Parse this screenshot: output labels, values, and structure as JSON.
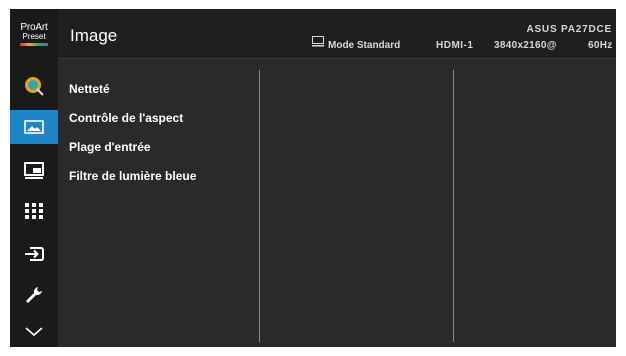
{
  "logo": {
    "line1": "ProArt",
    "line2": "Preset"
  },
  "sidebar": {
    "items": [
      {
        "icon": "palette-icon",
        "active": false
      },
      {
        "icon": "image-icon",
        "active": true
      },
      {
        "icon": "pip-icon",
        "active": false
      },
      {
        "icon": "grid-icon",
        "active": false
      },
      {
        "icon": "input-select-icon",
        "active": false
      },
      {
        "icon": "wrench-icon",
        "active": false
      },
      {
        "icon": "chevron-down-icon",
        "active": false
      }
    ]
  },
  "header": {
    "title": "Image",
    "mode": "Mode Standard",
    "input": "HDMI-1",
    "resolution": "3840x2160@",
    "refresh": "60Hz",
    "model": "ASUS PA27DCE"
  },
  "menu": {
    "items": [
      "Netteté",
      "Contrôle de l'aspect",
      "Plage d'entrée",
      "Filtre de lumière bleue"
    ]
  },
  "colors": {
    "accent": "#1d86c8",
    "background": "#2a2a2a",
    "sidebar": "#1a1a1a"
  }
}
